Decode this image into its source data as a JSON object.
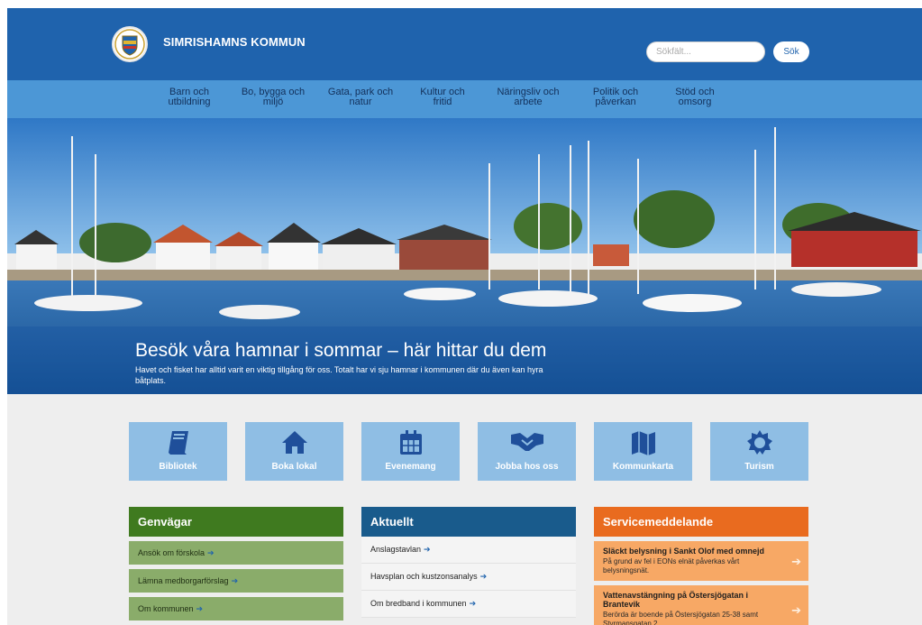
{
  "site": {
    "name": "SIMRISHAMNS KOMMUN",
    "logo": "municipal-crest"
  },
  "search": {
    "placeholder": "Sökfält...",
    "button_label": "Sök"
  },
  "nav": [
    {
      "label": "Barn och\nutbildning"
    },
    {
      "label": "Bo, bygga och\nmiljö"
    },
    {
      "label": "Gata, park och\nnatur"
    },
    {
      "label": "Kultur och\nfritid"
    },
    {
      "label": "Näringsliv och\narbete"
    },
    {
      "label": "Politik och\npåverkan"
    },
    {
      "label": "Stöd och\nomsorg"
    }
  ],
  "hero": {
    "title": "Besök våra hamnar i sommar – här hittar du dem",
    "text": "Havet och fisket har alltid varit en viktig tillgång för oss. Totalt har vi sju hamnar i kommunen där du även kan hyra båtplats."
  },
  "quick_links": [
    {
      "label": "Bibliotek",
      "icon": "book-icon"
    },
    {
      "label": "Boka lokal",
      "icon": "home-icon"
    },
    {
      "label": "Evenemang",
      "icon": "calendar-icon"
    },
    {
      "label": "Jobba hos oss",
      "icon": "handshake-icon"
    },
    {
      "label": "Kommunkarta",
      "icon": "map-icon"
    },
    {
      "label": "Turism",
      "icon": "sun-icon"
    }
  ],
  "genvagar": {
    "title": "Genvägar",
    "items": [
      {
        "label": "Ansök om förskola"
      },
      {
        "label": "Lämna medborgarförslag"
      },
      {
        "label": "Om kommunen"
      }
    ]
  },
  "aktuellt": {
    "title": "Aktuellt",
    "items": [
      {
        "label": "Anslagstavlan"
      },
      {
        "label": "Havsplan och kustzonsanalys"
      },
      {
        "label": "Om bredband i kommunen"
      }
    ]
  },
  "service": {
    "title": "Servicemeddelande",
    "items": [
      {
        "title": "Släckt belysning i Sankt Olof med omnejd",
        "text": "På grund av fel i EONs elnät påverkas vårt belysningsnät."
      },
      {
        "title": "Vattenavstängning på Östersjögatan i Brantevik",
        "text": "Berörda är boende på Östersjögatan 25-38 samt Styrmansgatan 2"
      }
    ]
  },
  "colors": {
    "header": "#1f63ad",
    "nav": "#4c97d6",
    "quick_tile": "#8fbee4",
    "genvagar": "#3f7a1f",
    "aktuellt": "#195b8c",
    "service": "#e96b1f"
  }
}
